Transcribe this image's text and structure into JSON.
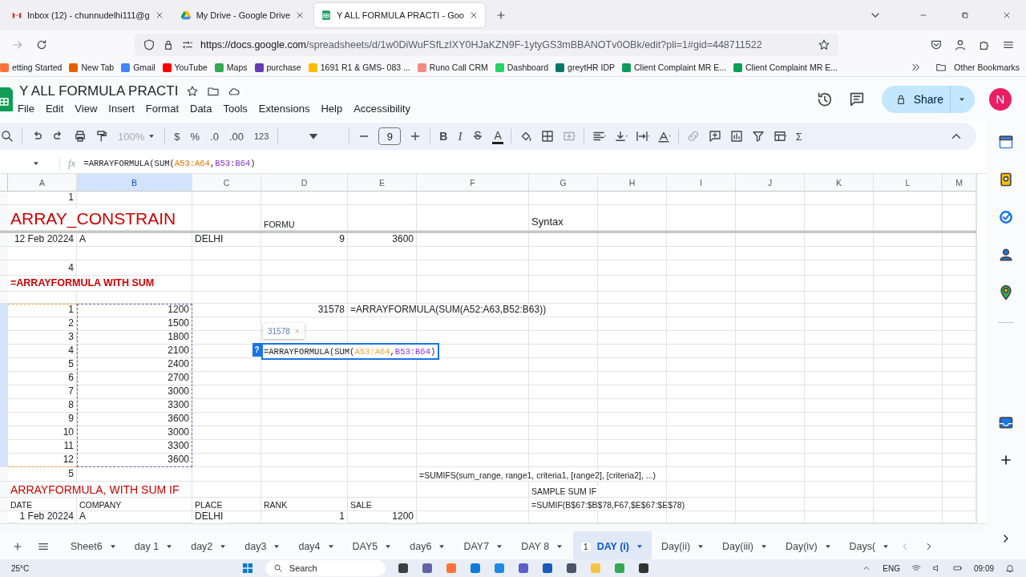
{
  "browser": {
    "tabs": [
      {
        "title": "Inbox (12) - chunnudelhi111@g",
        "kind": "mail",
        "selected": false
      },
      {
        "title": "My Drive - Google Drive",
        "kind": "drive",
        "selected": false
      },
      {
        "title": "Y ALL FORMULA PRACTI - Goo",
        "kind": "sheets",
        "selected": true
      }
    ],
    "url_host": "https://docs.google.com",
    "url_path": "/spreadsheets/d/1w0DiWuFSfLzIXY0HJaKZN9F-1ytyGS3mBBANOTv0OBk/edit?pli=1#gid=448711522",
    "bookmarks": [
      {
        "label": "etting Started",
        "color": "#ff7139"
      },
      {
        "label": "New Tab",
        "color": "#e66000"
      },
      {
        "label": "Gmail",
        "color": "#4285f4"
      },
      {
        "label": "YouTube",
        "color": "#ff0000"
      },
      {
        "label": "Maps",
        "color": "#34a853"
      },
      {
        "label": "purchase",
        "color": "#673ab7"
      },
      {
        "label": "1691 R1 & GMS- 083 ...",
        "color": "#fbbc04"
      },
      {
        "label": "Runo Call CRM",
        "color": "#f28b82"
      },
      {
        "label": "Dashboard",
        "color": "#25d366"
      },
      {
        "label": "greytHR IDP",
        "color": "#00796b"
      },
      {
        "label": "Client Complaint MR E...",
        "color": "#0f9d58"
      },
      {
        "label": "Client Complaint MR E...",
        "color": "#0f9d58"
      }
    ],
    "other_bookmarks": "Other Bookmarks"
  },
  "doc": {
    "title": "Y ALL FORMULA PRACTI",
    "menu": [
      "File",
      "Edit",
      "View",
      "Insert",
      "Format",
      "Data",
      "Tools",
      "Extensions",
      "Help",
      "Accessibility"
    ],
    "share": "Share",
    "avatar": "N"
  },
  "toolbar": {
    "zoom": "100%",
    "currency": "$",
    "percent": "%",
    "dec_less": ".0",
    "dec_more": ".00",
    "number_format": "123",
    "font_size": "9",
    "bold": "B",
    "italic": "I",
    "text_color": "A",
    "functions": "Σ"
  },
  "formula_bar": {
    "fx": "fx",
    "parts": [
      {
        "text": "=ARRAYFORMULA(SUM("
      },
      {
        "text": "A53:A64",
        "color": "#e37400"
      },
      {
        "text": ","
      },
      {
        "text": "B53:B64",
        "color": "#8430ce"
      },
      {
        "text": ")"
      }
    ]
  },
  "columns": [
    {
      "label": "A",
      "selected": false
    },
    {
      "label": "B",
      "selected": true
    },
    {
      "label": "C",
      "selected": false
    },
    {
      "label": "D",
      "selected": false
    },
    {
      "label": "E",
      "selected": false
    },
    {
      "label": "F",
      "selected": false
    },
    {
      "label": "G",
      "selected": false
    },
    {
      "label": "H",
      "selected": false
    },
    {
      "label": "I",
      "selected": false
    },
    {
      "label": "J",
      "selected": false
    },
    {
      "label": "K",
      "selected": false
    },
    {
      "label": "L",
      "selected": false
    },
    {
      "label": "M",
      "selected": false
    }
  ],
  "rows": [
    {
      "copied": false,
      "cells": {
        "A": {
          "text": "1",
          "kind": "number"
        }
      }
    },
    {
      "copied": false,
      "freeze_after": true,
      "cells": {
        "A": {
          "text": "ARRAY_CONSTRAIN",
          "kind": "title"
        },
        "D": {
          "text": "FORMU",
          "kind": "note"
        },
        "G": {
          "text": "Syntax",
          "kind": "large"
        }
      }
    },
    {
      "copied": false,
      "cells": {
        "A": {
          "text": "12 Feb 20224",
          "kind": "number"
        },
        "B": {
          "text": "A",
          "kind": "text"
        },
        "C": {
          "text": "DELHI",
          "kind": "text"
        },
        "D": {
          "text": "9",
          "kind": "number"
        },
        "E": {
          "text": "3600",
          "kind": "number"
        }
      }
    },
    {
      "copied": false
    },
    {
      "copied": false,
      "cells": {
        "A": {
          "text": "4",
          "kind": "number"
        }
      }
    },
    {
      "copied": false,
      "cells": {
        "A": {
          "text": "=ARRAYFORMULA WITH SUM",
          "kind": "heading"
        }
      }
    },
    {
      "copied": false
    },
    {
      "copied": true,
      "cells": {
        "A": {
          "text": "1",
          "kind": "number"
        },
        "B": {
          "text": "1200",
          "kind": "number"
        },
        "D": {
          "text": "31578",
          "kind": "number"
        },
        "E": {
          "text": "=ARRAYFORMULA(SUM(A52:A63,B52:B63))",
          "kind": "text"
        }
      }
    },
    {
      "copied": true,
      "cells": {
        "A": {
          "text": "2",
          "kind": "number"
        },
        "B": {
          "text": "1500",
          "kind": "number"
        }
      }
    },
    {
      "copied": true,
      "cells": {
        "A": {
          "text": "3",
          "kind": "number"
        },
        "B": {
          "text": "1800",
          "kind": "number"
        }
      }
    },
    {
      "copied": true,
      "cells": {
        "A": {
          "text": "4",
          "kind": "number"
        },
        "B": {
          "text": "2100",
          "kind": "number"
        },
        "D": {
          "kind": "editor",
          "help": "?",
          "preview": "31578",
          "preview_close": "×",
          "parts": [
            {
              "text": "=ARRAYFORMULA(SUM("
            },
            {
              "text": "A53:A64",
              "color": "#f4a52c"
            },
            {
              "text": ","
            },
            {
              "text": "B53:B64",
              "color": "#9334e6"
            },
            {
              "text": ")"
            }
          ]
        }
      }
    },
    {
      "copied": true,
      "cells": {
        "A": {
          "text": "5",
          "kind": "number"
        },
        "B": {
          "text": "2400",
          "kind": "number"
        }
      }
    },
    {
      "copied": true,
      "cells": {
        "A": {
          "text": "6",
          "kind": "number"
        },
        "B": {
          "text": "2700",
          "kind": "number"
        }
      }
    },
    {
      "copied": true,
      "cells": {
        "A": {
          "text": "7",
          "kind": "number"
        },
        "B": {
          "text": "3000",
          "kind": "number"
        }
      }
    },
    {
      "copied": true,
      "cells": {
        "A": {
          "text": "8",
          "kind": "number"
        },
        "B": {
          "text": "3300",
          "kind": "number"
        }
      }
    },
    {
      "copied": true,
      "cells": {
        "A": {
          "text": "9",
          "kind": "number"
        },
        "B": {
          "text": "3600",
          "kind": "number"
        }
      }
    },
    {
      "copied": true,
      "cells": {
        "A": {
          "text": "10",
          "kind": "number"
        },
        "B": {
          "text": "3000",
          "kind": "number"
        }
      }
    },
    {
      "copied": true,
      "cells": {
        "A": {
          "text": "11",
          "kind": "number"
        },
        "B": {
          "text": "3300",
          "kind": "number"
        }
      }
    },
    {
      "copied": true,
      "cells": {
        "A": {
          "text": "12",
          "kind": "number"
        },
        "B": {
          "text": "3600",
          "kind": "number"
        }
      }
    },
    {
      "copied": false,
      "cells": {
        "A": {
          "text": "5",
          "kind": "number"
        },
        "F": {
          "text": "=SUMIFS(sum_range, range1, criteria1, [range2], [criteria2], ...)",
          "kind": "note"
        }
      }
    },
    {
      "copied": false,
      "cells": {
        "A": {
          "text": "ARRAYFORMULA, WITH SUM IF",
          "kind": "subtitle"
        },
        "G": {
          "text": "SAMPLE SUM IF",
          "kind": "note"
        }
      }
    },
    {
      "copied": false,
      "cells": {
        "A": {
          "text": "DATE",
          "kind": "note"
        },
        "B": {
          "text": "COMPANY",
          "kind": "note"
        },
        "C": {
          "text": "PLACE",
          "kind": "note"
        },
        "D": {
          "text": "RANK",
          "kind": "note"
        },
        "E": {
          "text": "SALE",
          "kind": "note"
        },
        "G": {
          "text": "=SUMIF(B$67:$B$78,F67,$E$67:$E$78)",
          "kind": "note"
        }
      }
    },
    {
      "copied": false,
      "cells": {
        "A": {
          "text": "1 Feb 20224",
          "kind": "number"
        },
        "B": {
          "text": "A",
          "kind": "text"
        },
        "C": {
          "text": "DELHI",
          "kind": "text"
        },
        "D": {
          "text": "1",
          "kind": "number"
        },
        "E": {
          "text": "1200",
          "kind": "number"
        }
      }
    }
  ],
  "sheet_tabs": [
    {
      "label": "Sheet6",
      "selected": false
    },
    {
      "label": "day 1",
      "selected": false
    },
    {
      "label": "day2",
      "selected": false
    },
    {
      "label": "day3",
      "selected": false
    },
    {
      "label": "day4",
      "selected": false
    },
    {
      "label": "DAY5",
      "selected": false
    },
    {
      "label": "day6",
      "selected": false
    },
    {
      "label": "DAY7",
      "selected": false
    },
    {
      "label": "DAY 8",
      "selected": false
    },
    {
      "label": "DAY (i)",
      "selected": true,
      "badge": "1"
    },
    {
      "label": "Day(ii)",
      "selected": false
    },
    {
      "label": "Day(iii)",
      "selected": false
    },
    {
      "label": "Day(iv)",
      "selected": false
    },
    {
      "label": "Days(",
      "selected": false
    }
  ],
  "taskbar": {
    "weather": "25°C",
    "search": "Search",
    "language": "ENG",
    "time": "09:09"
  }
}
